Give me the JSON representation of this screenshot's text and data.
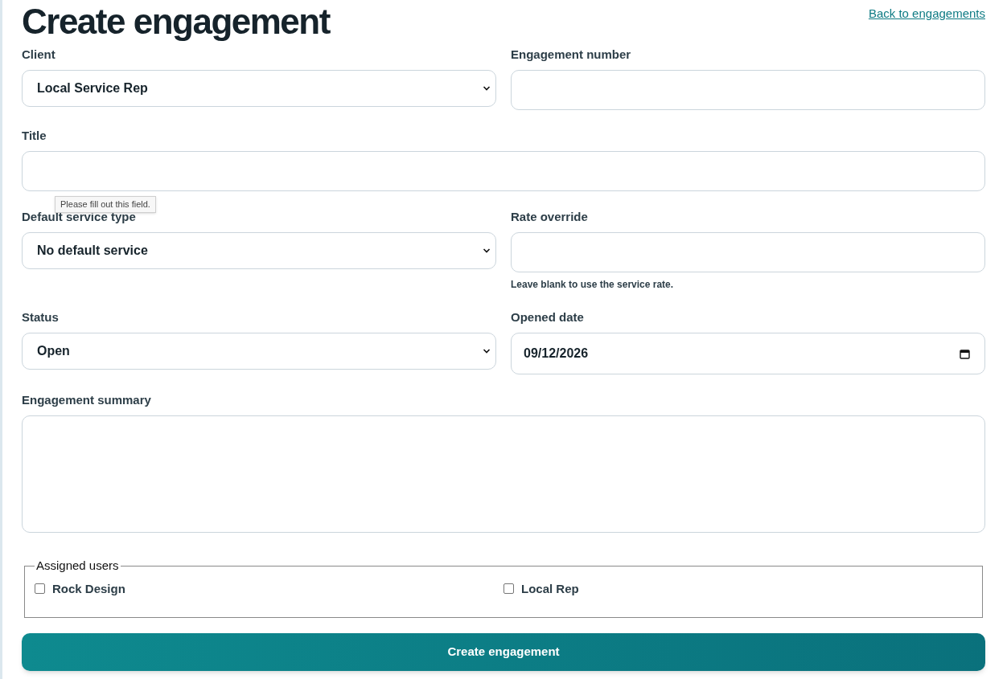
{
  "title": "Create engagement",
  "back_link": "Back to engagements",
  "rows": [
    [
      {
        "kind": "select",
        "label": "Client",
        "value": "Local Service Rep"
      },
      {
        "kind": "input",
        "label": "Engagement number"
      }
    ],
    [
      {
        "kind": "input",
        "label": "Title"
      }
    ],
    [
      {
        "kind": "select",
        "label": "Default service type",
        "value": "No default service",
        "tooltip": "Please fill out this field."
      },
      {
        "kind": "input",
        "label": "Rate override",
        "help": "Leave blank to use the service rate."
      }
    ],
    [
      {
        "kind": "select",
        "label": "Status",
        "value": "Open"
      },
      {
        "kind": "date",
        "label": "Opened date",
        "value": "09/12/2026"
      }
    ],
    [
      {
        "kind": "textarea",
        "label": "Engagement summary"
      }
    ]
  ],
  "assigned_users": {
    "legend": "Assigned users",
    "users": [
      {
        "name": "Rock Design",
        "checked": false
      },
      {
        "name": "Local Rep",
        "checked": false
      }
    ]
  },
  "submit": "Create engagement"
}
